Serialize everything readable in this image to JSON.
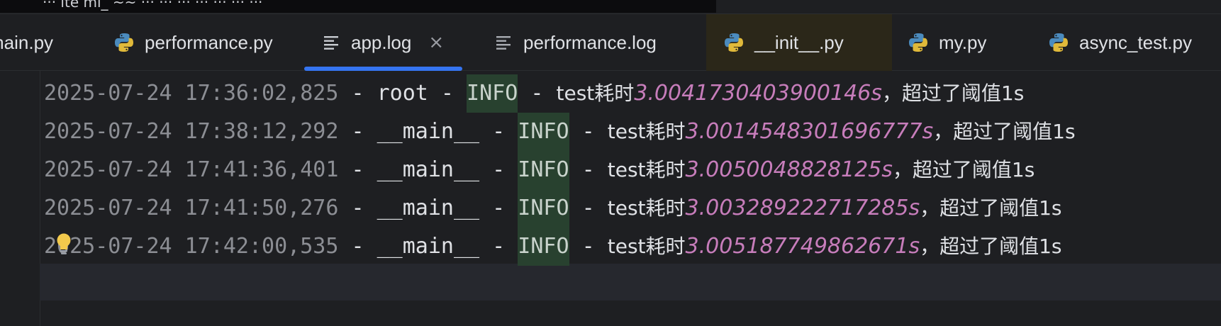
{
  "breadcrumb": "···  ite   ml_   ~~   ···  ···  ···  ···  ···  ···  ···",
  "tabs": [
    {
      "label": "main.py",
      "icon": "python-icon",
      "active": false
    },
    {
      "label": "performance.py",
      "icon": "python-icon",
      "active": false
    },
    {
      "label": "app.log",
      "icon": "log-file-icon",
      "active": true,
      "close": "×"
    },
    {
      "label": "performance.log",
      "icon": "log-file-icon",
      "active": false
    },
    {
      "label": "__init__.py",
      "icon": "python-icon",
      "active": false
    },
    {
      "label": "my.py",
      "icon": "python-icon",
      "active": false
    },
    {
      "label": "async_test.py",
      "icon": "python-icon",
      "active": false
    }
  ],
  "log_lines": [
    {
      "timestamp": "2025-07-24 17:36:02,825",
      "logger": "root",
      "level": "INFO",
      "msg_prefix": "test耗时",
      "duration": "3.0041730403900146s",
      "msg_suffix": "，超过了阈值1s"
    },
    {
      "timestamp": "2025-07-24 17:38:12,292",
      "logger": "__main__",
      "level": "INFO",
      "msg_prefix": "test耗时",
      "duration": "3.0014548301696777s",
      "msg_suffix": "，超过了阈值1s"
    },
    {
      "timestamp": "2025-07-24 17:41:36,401",
      "logger": "__main__",
      "level": "INFO",
      "msg_prefix": "test耗时",
      "duration": "3.0050048828125s",
      "msg_suffix": "，超过了阈值1s"
    },
    {
      "timestamp": "2025-07-24 17:41:50,276",
      "logger": "__main__",
      "level": "INFO",
      "msg_prefix": "test耗时",
      "duration": "3.003289222717285s",
      "msg_suffix": "，超过了阈值1s"
    },
    {
      "timestamp": "2025-07-24 17:42:00,535",
      "logger": "__main__",
      "level": "INFO",
      "msg_prefix": "test耗时",
      "duration": "3.005187749862671s",
      "msg_suffix": "，超过了阈值1s"
    }
  ],
  "separator": " - ",
  "colors": {
    "accent": "#3574f0",
    "level_highlight": "#28412f",
    "number": "#c77dbb",
    "timestamp": "#8c8e94"
  }
}
